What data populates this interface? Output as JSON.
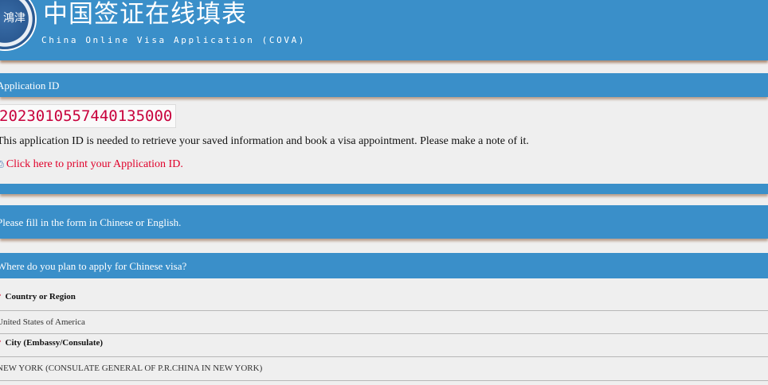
{
  "header": {
    "cn_title": "中国签证在线填表",
    "en_title": "China Online Visa Application (COVA)",
    "logo_text": "鴻津"
  },
  "application": {
    "section_label": "Application ID",
    "id": "2023010557440135000",
    "note": "This application ID is needed to retrieve your saved information and book a visa appointment. Please make a note of it.",
    "print_link": "Click here to print your Application ID."
  },
  "fill_note": "Please fill in the form in Chinese or English.",
  "where": {
    "section_label": "Where do you plan to apply for Chinese visa?",
    "required_mark": "*",
    "country_label": "Country or Region",
    "country_value": "United States of America",
    "city_label": "City (Embassy/Consulate)",
    "city_value": "NEW YORK (CONSULATE GENERAL OF P.R.CHINA IN NEW YORK)"
  },
  "colors": {
    "header_blue": "#3a8fc9",
    "link_red": "#e0002a",
    "id_red": "#c8003c",
    "page_bg": "#efefef"
  },
  "icons": {
    "logo": "ministry-emblem-icon",
    "print": "printer-icon"
  }
}
